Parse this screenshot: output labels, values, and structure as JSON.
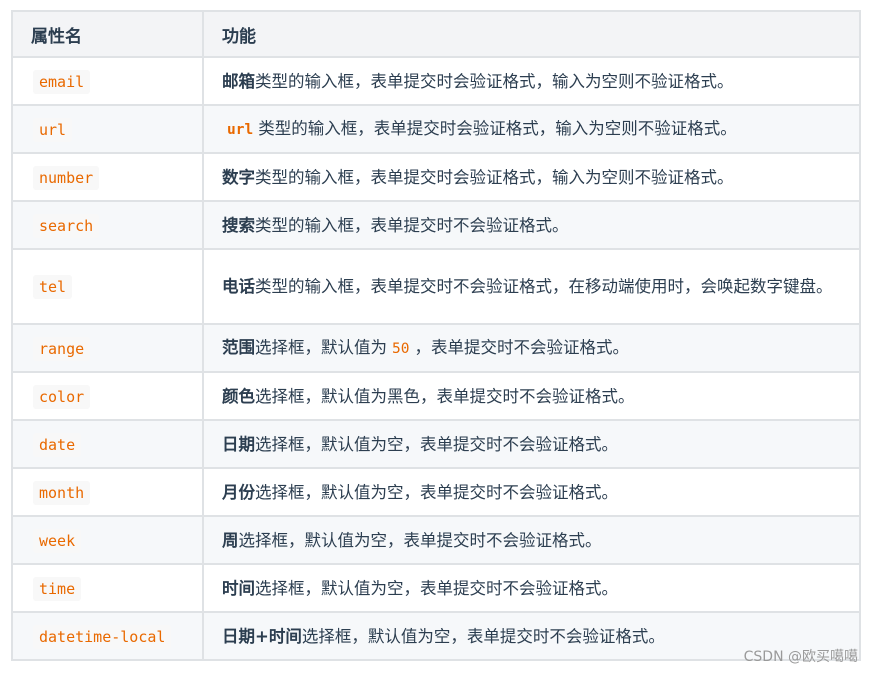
{
  "table": {
    "headers": [
      "属性名",
      "功能"
    ],
    "rows": [
      {
        "attr": "email",
        "bold": "邮箱",
        "text": "类型的输入框，表单提交时会验证格式，输入为空则不验证格式。"
      },
      {
        "attr": "url",
        "code": "url",
        "text": "类型的输入框，表单提交时会验证格式，输入为空则不验证格式。"
      },
      {
        "attr": "number",
        "bold": "数字",
        "text": "类型的输入框，表单提交时会验证格式，输入为空则不验证格式。"
      },
      {
        "attr": "search",
        "bold": "搜索",
        "text": "类型的输入框，表单提交时不会验证格式。"
      },
      {
        "attr": "tel",
        "bold": "电话",
        "text": "类型的输入框，表单提交时不会验证格式，在移动端使用时，会唤起数字键盘。"
      },
      {
        "attr": "range",
        "bold": "范围",
        "text_before": "选择框，默认值为",
        "code": "50",
        "text_after": "，表单提交时不会验证格式。"
      },
      {
        "attr": "color",
        "bold": "颜色",
        "text": "选择框，默认值为黑色，表单提交时不会验证格式。"
      },
      {
        "attr": "date",
        "bold": "日期",
        "text": "选择框，默认值为空，表单提交时不会验证格式。"
      },
      {
        "attr": "month",
        "bold": "月份",
        "text": "选择框，默认值为空，表单提交时不会验证格式。"
      },
      {
        "attr": "week",
        "bold": "周",
        "text": "选择框，默认值为空，表单提交时不会验证格式。"
      },
      {
        "attr": "time",
        "bold": "时间",
        "text": "选择框，默认值为空，表单提交时不会验证格式。"
      },
      {
        "attr": "datetime-local",
        "bold": "日期+时间",
        "text": "选择框，默认值为空，表单提交时不会验证格式。"
      }
    ]
  },
  "watermark": "CSDN @欧买噶噶",
  "colors": {
    "code_text": "#e96900",
    "header_bg": "#f3f4f6",
    "stripe_bg": "#f6f8fa",
    "border": "#dfe2e5",
    "text": "#2c3e50"
  }
}
